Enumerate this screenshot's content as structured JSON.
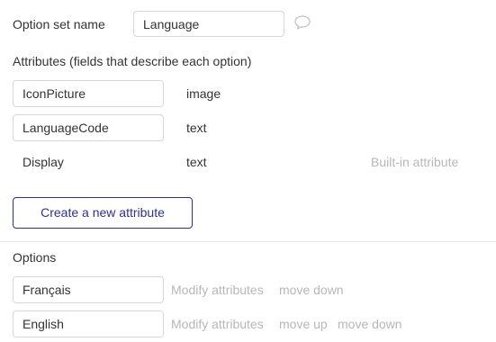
{
  "option_set": {
    "name_label": "Option set name",
    "name_value": "Language",
    "comment_icon": "comment-bubble-icon"
  },
  "attributes": {
    "heading": "Attributes (fields that describe each option)",
    "rows": [
      {
        "name": "IconPicture",
        "type": "image",
        "note": ""
      },
      {
        "name": "LanguageCode",
        "type": "text",
        "note": ""
      },
      {
        "name": "Display",
        "type": "text",
        "note": "Built-in attribute"
      }
    ],
    "create_button": "Create a new attribute"
  },
  "options": {
    "heading": "Options",
    "rows": [
      {
        "name": "Français",
        "actions": [
          "Modify attributes",
          "move down"
        ]
      },
      {
        "name": "English",
        "actions": [
          "Modify attributes",
          "move up",
          "move down"
        ]
      }
    ]
  },
  "colors": {
    "accent": "#2f3192",
    "muted_text": "#b7b7b7",
    "border": "#d7d7d7"
  }
}
